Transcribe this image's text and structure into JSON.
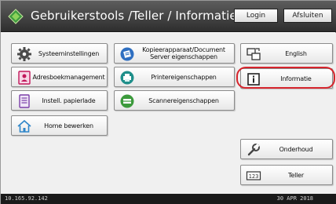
{
  "header": {
    "title": "Gebruikerstools /Teller / Informatie",
    "login_label": "Login",
    "logout_label": "Afsluiten"
  },
  "left_column": [
    {
      "label": "Systeeminstellingen",
      "icon": "gear-icon"
    },
    {
      "label": "Adresboekmanagement",
      "icon": "address-book-icon"
    },
    {
      "label": "Instell. papierlade",
      "icon": "paper-tray-icon"
    },
    {
      "label": "Home bewerken",
      "icon": "home-icon"
    }
  ],
  "middle_column": [
    {
      "label": "Kopieerapparaat/Document Server eigenschappen",
      "icon": "copier-icon"
    },
    {
      "label": "Printereigenschappen",
      "icon": "printer-icon"
    },
    {
      "label": "Scannereigenschappen",
      "icon": "scanner-icon"
    }
  ],
  "right_column": {
    "english_label": "English",
    "informatie_label": "Informatie",
    "onderhoud_label": "Onderhoud",
    "teller_label": "Teller"
  },
  "highlight": {
    "target": "Informatie",
    "color": "#d6242c"
  },
  "footer": {
    "ip": "10.165.92.142",
    "date": "30 APR 2018"
  },
  "colors": {
    "header_bg": "#3a3a3a",
    "panel_bg": "#f0f0f0",
    "accent_blue": "#2f6fc1"
  }
}
